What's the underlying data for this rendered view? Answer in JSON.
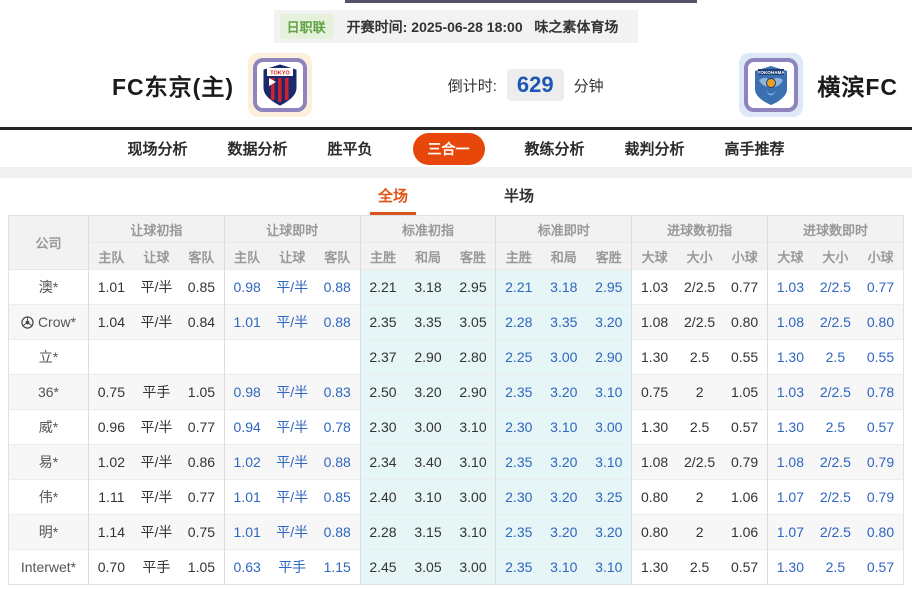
{
  "header": {
    "league": "日职联",
    "kickoff_label": "开赛时间:",
    "kickoff_time": "2025-06-28 18:00",
    "venue": "味之素体育场",
    "home_team": "FC东京(主)",
    "away_team": "横滨FC",
    "home_logo": "fc-tokyo-crest",
    "away_logo": "yokohama-fc-crest",
    "countdown_label": "倒计时:",
    "countdown_value": "629",
    "countdown_unit": "分钟"
  },
  "nav": {
    "tabs": [
      {
        "label": "现场分析",
        "active": false
      },
      {
        "label": "数据分析",
        "active": false
      },
      {
        "label": "胜平负",
        "active": false
      },
      {
        "label": "三合一",
        "active": true
      },
      {
        "label": "教练分析",
        "active": false
      },
      {
        "label": "裁判分析",
        "active": false
      },
      {
        "label": "高手推荐",
        "active": false
      }
    ]
  },
  "subtabs": [
    {
      "label": "全场",
      "active": true
    },
    {
      "label": "半场",
      "active": false
    }
  ],
  "table": {
    "company_header": "公司",
    "groups": [
      {
        "label": "让球初指",
        "cols": [
          "主队",
          "让球",
          "客队"
        ]
      },
      {
        "label": "让球即时",
        "cols": [
          "主队",
          "让球",
          "客队"
        ]
      },
      {
        "label": "标准初指",
        "cols": [
          "主胜",
          "和局",
          "客胜"
        ]
      },
      {
        "label": "标准即时",
        "cols": [
          "主胜",
          "和局",
          "客胜"
        ]
      },
      {
        "label": "进球数初指",
        "cols": [
          "大球",
          "大小",
          "小球"
        ]
      },
      {
        "label": "进球数即时",
        "cols": [
          "大球",
          "大小",
          "小球"
        ]
      }
    ],
    "rows": [
      {
        "company": "澳*",
        "icon": null,
        "cells": [
          "1.01",
          "平/半",
          "0.85",
          "0.98",
          "平/半",
          "0.88",
          "2.21",
          "3.18",
          "2.95",
          "2.21",
          "3.18",
          "2.95",
          "1.03",
          "2/2.5",
          "0.77",
          "1.03",
          "2/2.5",
          "0.77"
        ]
      },
      {
        "company": "Crow*",
        "icon": "soccer-ball",
        "cells": [
          "1.04",
          "平/半",
          "0.84",
          "1.01",
          "平/半",
          "0.88",
          "2.35",
          "3.35",
          "3.05",
          "2.28",
          "3.35",
          "3.20",
          "1.08",
          "2/2.5",
          "0.80",
          "1.08",
          "2/2.5",
          "0.80"
        ]
      },
      {
        "company": "立*",
        "icon": null,
        "cells": [
          "",
          "",
          "",
          "",
          "",
          "",
          "2.37",
          "2.90",
          "2.80",
          "2.25",
          "3.00",
          "2.90",
          "1.30",
          "2.5",
          "0.55",
          "1.30",
          "2.5",
          "0.55"
        ]
      },
      {
        "company": "36*",
        "icon": null,
        "cells": [
          "0.75",
          "平手",
          "1.05",
          "0.98",
          "平/半",
          "0.83",
          "2.50",
          "3.20",
          "2.90",
          "2.35",
          "3.20",
          "3.10",
          "0.75",
          "2",
          "1.05",
          "1.03",
          "2/2.5",
          "0.78"
        ]
      },
      {
        "company": "威*",
        "icon": null,
        "cells": [
          "0.96",
          "平/半",
          "0.77",
          "0.94",
          "平/半",
          "0.78",
          "2.30",
          "3.00",
          "3.10",
          "2.30",
          "3.10",
          "3.00",
          "1.30",
          "2.5",
          "0.57",
          "1.30",
          "2.5",
          "0.57"
        ]
      },
      {
        "company": "易*",
        "icon": null,
        "cells": [
          "1.02",
          "平/半",
          "0.86",
          "1.02",
          "平/半",
          "0.88",
          "2.34",
          "3.40",
          "3.10",
          "2.35",
          "3.20",
          "3.10",
          "1.08",
          "2/2.5",
          "0.79",
          "1.08",
          "2/2.5",
          "0.79"
        ]
      },
      {
        "company": "伟*",
        "icon": null,
        "cells": [
          "1.11",
          "平/半",
          "0.77",
          "1.01",
          "平/半",
          "0.85",
          "2.40",
          "3.10",
          "3.00",
          "2.30",
          "3.20",
          "3.25",
          "0.80",
          "2",
          "1.06",
          "1.07",
          "2/2.5",
          "0.79"
        ]
      },
      {
        "company": "明*",
        "icon": null,
        "cells": [
          "1.14",
          "平/半",
          "0.75",
          "1.01",
          "平/半",
          "0.88",
          "2.28",
          "3.15",
          "3.10",
          "2.35",
          "3.20",
          "3.20",
          "0.80",
          "2",
          "1.06",
          "1.07",
          "2/2.5",
          "0.80"
        ]
      },
      {
        "company": "Interwet*",
        "icon": null,
        "cells": [
          "0.70",
          "平手",
          "1.05",
          "0.63",
          "平手",
          "1.15",
          "2.45",
          "3.05",
          "3.00",
          "2.35",
          "3.10",
          "3.10",
          "1.30",
          "2.5",
          "0.57",
          "1.30",
          "2.5",
          "0.57"
        ]
      }
    ]
  },
  "colors": {
    "accent_orange": "#e8470b",
    "subtab_orange": "#d9541e",
    "live_blue": "#2f66c0",
    "countdown_blue": "#1c57b5",
    "standard_bg": "#e6f5f6",
    "league_green": "#61a243",
    "league_green_bg": "#e5f1db"
  }
}
